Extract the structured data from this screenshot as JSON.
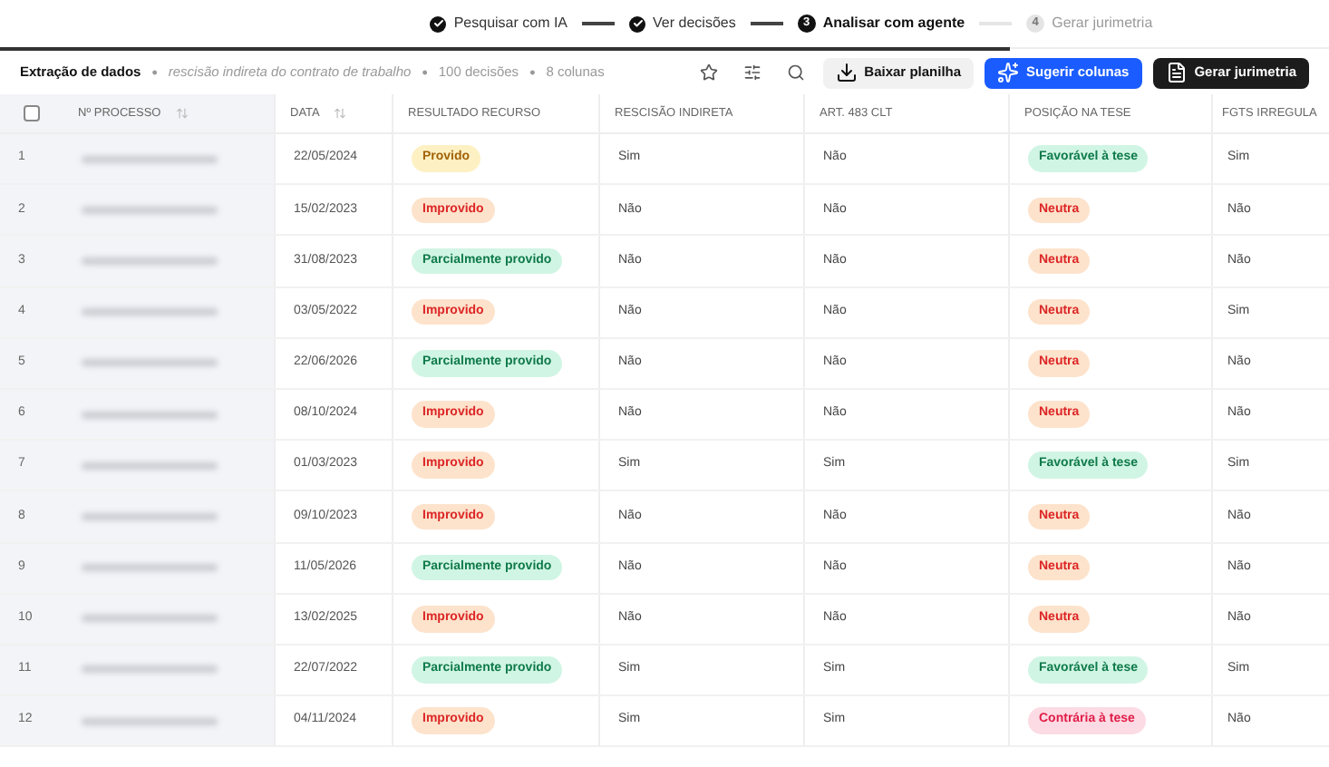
{
  "stepper": [
    {
      "label": "Pesquisar com IA",
      "completed": true,
      "selected": false
    },
    {
      "label": "Ver decisões",
      "completed": true,
      "selected": false
    },
    {
      "label": "Analisar com agente",
      "completed": false,
      "selected": true,
      "number": "3"
    },
    {
      "label": "Gerar jurimetria",
      "completed": false,
      "selected": false,
      "number": "4"
    }
  ],
  "progress": {
    "level": 0.76
  },
  "toolbar": {
    "meta": [
      {
        "kind": "title",
        "text": "Extração de dados"
      },
      {
        "kind": "separator",
        "text": "•"
      },
      {
        "kind": "query",
        "text": "rescisão indireta do contrato de trabalho"
      },
      {
        "kind": "separator",
        "text": "•"
      },
      {
        "kind": "info",
        "text": "100 decisões"
      },
      {
        "kind": "separator",
        "text": "•"
      },
      {
        "kind": "info",
        "text": "8 colunas"
      }
    ],
    "buttons": [
      {
        "label": "Baixar planilha",
        "kind": "secondary"
      },
      {
        "label": "Sugerir colunas",
        "kind": "primary"
      },
      {
        "label": "Gerar jurimetria",
        "kind": "dark"
      }
    ]
  },
  "table": {
    "select_all": {
      "checked": false
    },
    "columns": [
      {
        "label": "Nº PROCESSO",
        "sortable": true
      },
      {
        "label": "DATA",
        "sortable": true
      },
      {
        "label": "RESULTADO RECURSO",
        "sortable": false
      },
      {
        "label": "RESCISÃO INDIRETA",
        "sortable": false
      },
      {
        "label": "ART. 483 CLT",
        "sortable": false
      },
      {
        "label": "POSIÇÃO NA TESE",
        "sortable": false
      },
      {
        "label": "FGTS IRREGULA",
        "sortable": false
      }
    ],
    "rows": [
      {
        "index": "1",
        "date": "22/05/2024",
        "resultado": {
          "label": "Provido",
          "kind": "yellow"
        },
        "rescisao": "Sim",
        "art483": "Não",
        "posicao": {
          "label": "Favorável à tese",
          "kind": "green"
        },
        "fgts": "Sim"
      },
      {
        "index": "2",
        "date": "15/02/2023",
        "resultado": {
          "label": "Improvido",
          "kind": "orange"
        },
        "rescisao": "Não",
        "art483": "Não",
        "posicao": {
          "label": "Neutra",
          "kind": "orange"
        },
        "fgts": "Não"
      },
      {
        "index": "3",
        "date": "31/08/2023",
        "resultado": {
          "label": "Parcialmente provido",
          "kind": "green"
        },
        "rescisao": "Não",
        "art483": "Não",
        "posicao": {
          "label": "Neutra",
          "kind": "orange"
        },
        "fgts": "Não"
      },
      {
        "index": "4",
        "date": "03/05/2022",
        "resultado": {
          "label": "Improvido",
          "kind": "orange"
        },
        "rescisao": "Não",
        "art483": "Não",
        "posicao": {
          "label": "Neutra",
          "kind": "orange"
        },
        "fgts": "Sim"
      },
      {
        "index": "5",
        "date": "22/06/2026",
        "resultado": {
          "label": "Parcialmente provido",
          "kind": "green"
        },
        "rescisao": "Não",
        "art483": "Não",
        "posicao": {
          "label": "Neutra",
          "kind": "orange"
        },
        "fgts": "Não"
      },
      {
        "index": "6",
        "date": "08/10/2024",
        "resultado": {
          "label": "Improvido",
          "kind": "orange"
        },
        "rescisao": "Não",
        "art483": "Não",
        "posicao": {
          "label": "Neutra",
          "kind": "orange"
        },
        "fgts": "Não"
      },
      {
        "index": "7",
        "date": "01/03/2023",
        "resultado": {
          "label": "Improvido",
          "kind": "orange"
        },
        "rescisao": "Sim",
        "art483": "Sim",
        "posicao": {
          "label": "Favorável à tese",
          "kind": "green"
        },
        "fgts": "Sim"
      },
      {
        "index": "8",
        "date": "09/10/2023",
        "resultado": {
          "label": "Improvido",
          "kind": "orange"
        },
        "rescisao": "Não",
        "art483": "Não",
        "posicao": {
          "label": "Neutra",
          "kind": "orange"
        },
        "fgts": "Não"
      },
      {
        "index": "9",
        "date": "11/05/2026",
        "resultado": {
          "label": "Parcialmente provido",
          "kind": "green"
        },
        "rescisao": "Não",
        "art483": "Não",
        "posicao": {
          "label": "Neutra",
          "kind": "orange"
        },
        "fgts": "Não"
      },
      {
        "index": "10",
        "date": "13/02/2025",
        "resultado": {
          "label": "Improvido",
          "kind": "orange"
        },
        "rescisao": "Não",
        "art483": "Não",
        "posicao": {
          "label": "Neutra",
          "kind": "orange"
        },
        "fgts": "Não"
      },
      {
        "index": "11",
        "date": "22/07/2022",
        "resultado": {
          "label": "Parcialmente provido",
          "kind": "green"
        },
        "rescisao": "Sim",
        "art483": "Sim",
        "posicao": {
          "label": "Favorável à tese",
          "kind": "green"
        },
        "fgts": "Sim"
      },
      {
        "index": "12",
        "date": "04/11/2024",
        "resultado": {
          "label": "Improvido",
          "kind": "orange"
        },
        "rescisao": "Sim",
        "art483": "Sim",
        "posicao": {
          "label": "Contrária à tese",
          "kind": "pink"
        },
        "fgts": "Não"
      }
    ]
  }
}
